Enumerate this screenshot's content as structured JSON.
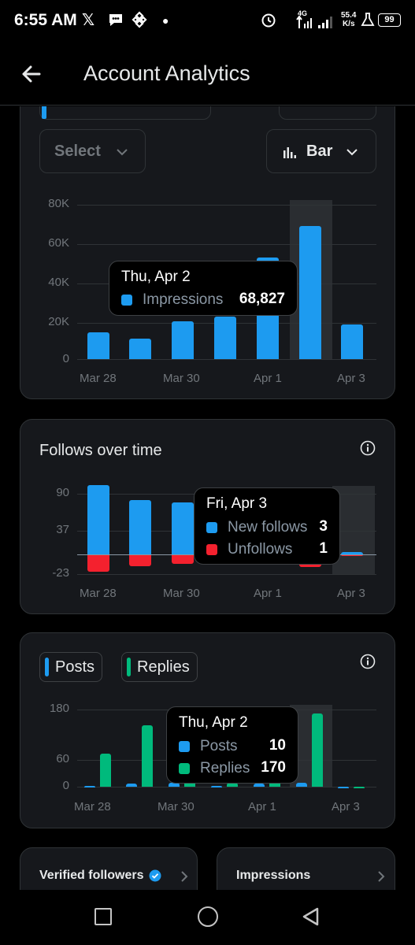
{
  "status_bar": {
    "time": "6:55 AM",
    "network": "4G",
    "speed": "55.4",
    "speed_unit": "K/s",
    "battery": "99",
    "icons": [
      "x-icon",
      "chat-icon",
      "binance-icon",
      "dot-icon",
      "alarm-icon",
      "data-arrows-icon",
      "signal-icon",
      "signal-icon",
      "flask-icon",
      "battery-icon"
    ]
  },
  "header": {
    "title": "Account Analytics",
    "back_icon": "arrow-left-icon"
  },
  "controls": {
    "select_label": "Select",
    "bar_label": "Bar",
    "bar_icon": "bar-chart-icon",
    "chevron_icon": "chevron-down-icon"
  },
  "colors": {
    "accent_blue": "#1d9bf0",
    "unfollow_red": "#f4212e",
    "reply_green": "#00ba7c",
    "card_bg": "#16181c",
    "border": "#2f3336"
  },
  "impressions_chart": {
    "x_labels": [
      "Mar 28",
      "Mar 30",
      "Apr 1",
      "Apr 3"
    ],
    "y_labels": [
      "80K",
      "60K",
      "40K",
      "20K",
      "0"
    ],
    "tooltip": {
      "date": "Thu, Apr 2",
      "series": "Impressions",
      "value": "68,827"
    }
  },
  "follows_chart": {
    "title": "Follows over time",
    "x_labels": [
      "Mar 28",
      "Mar 30",
      "Apr 1",
      "Apr 3"
    ],
    "y_labels": [
      "90",
      "37",
      "-23"
    ],
    "tooltip": {
      "date": "Fri, Apr 3",
      "new_label": "New follows",
      "new_value": "3",
      "unf_label": "Unfollows",
      "unf_value": "1"
    }
  },
  "posts_chart": {
    "legend_posts": "Posts",
    "legend_replies": "Replies",
    "x_labels": [
      "Mar 28",
      "Mar 30",
      "Apr 1",
      "Apr 3"
    ],
    "y_labels": [
      "180",
      "60",
      "0"
    ],
    "tooltip": {
      "date": "Thu, Apr 2",
      "posts_label": "Posts",
      "posts_value": "10",
      "replies_label": "Replies",
      "replies_value": "170"
    }
  },
  "bottom_cards": {
    "verified_title": "Verified followers",
    "impressions_title": "Impressions",
    "verified_icon": "verified-badge-icon",
    "chevron_icon": "chevron-right-icon"
  },
  "chart_data": [
    {
      "type": "bar",
      "title": "",
      "categories": [
        "Mar 28",
        "Mar 29",
        "Mar 30",
        "Mar 31",
        "Apr 1",
        "Apr 2",
        "Apr 3"
      ],
      "series": [
        {
          "name": "Impressions",
          "values": [
            14000,
            10500,
            19500,
            22000,
            52500,
            68827,
            18000
          ]
        }
      ],
      "ylim": [
        0,
        80000
      ],
      "highlighted_category": "Apr 2"
    },
    {
      "type": "bar",
      "title": "Follows over time",
      "categories": [
        "Mar 28",
        "Mar 29",
        "Mar 30",
        "Mar 31",
        "Apr 1",
        "Apr 2",
        "Apr 3"
      ],
      "series": [
        {
          "name": "New follows",
          "values": [
            90,
            71,
            68,
            60,
            45,
            30,
            3
          ]
        },
        {
          "name": "Unfollows",
          "values": [
            -23,
            -15,
            -12,
            -10,
            -10,
            -16,
            -1
          ]
        }
      ],
      "ylim": [
        -23,
        90
      ],
      "highlighted_category": "Apr 3"
    },
    {
      "type": "bar",
      "categories": [
        "Mar 28",
        "Mar 29",
        "Mar 30",
        "Mar 31",
        "Apr 1",
        "Apr 2",
        "Apr 3"
      ],
      "series": [
        {
          "name": "Posts",
          "values": [
            1,
            7,
            9,
            2,
            8,
            10,
            0
          ]
        },
        {
          "name": "Replies",
          "values": [
            77,
            143,
            12,
            10,
            14,
            170,
            0
          ]
        }
      ],
      "ylim": [
        0,
        180
      ],
      "highlighted_category": "Apr 2"
    }
  ],
  "nav": {
    "icons": [
      "recents-square-icon",
      "home-circle-icon",
      "back-triangle-icon"
    ]
  }
}
